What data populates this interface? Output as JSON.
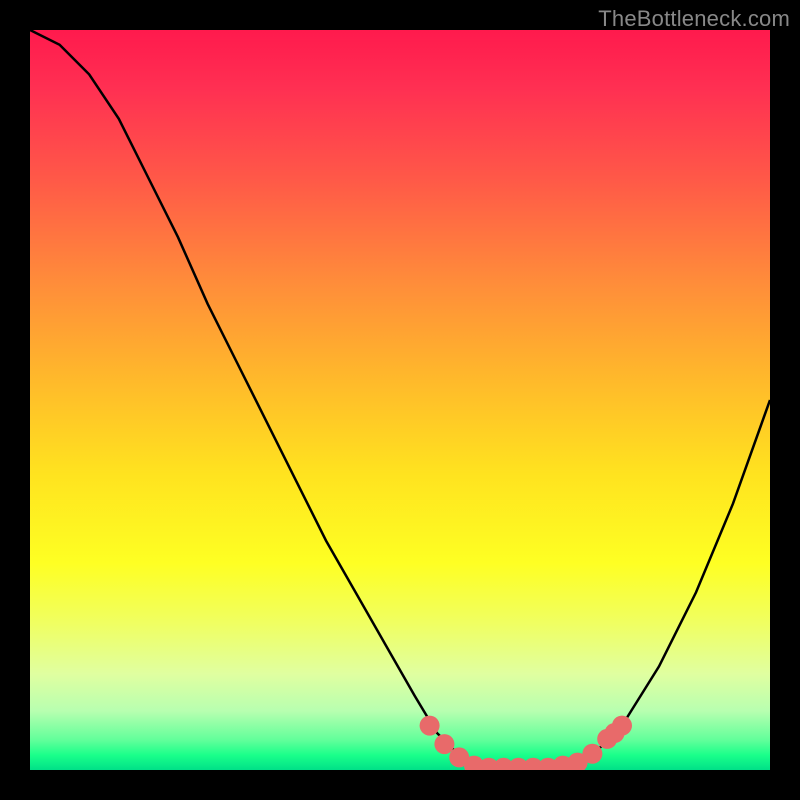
{
  "watermark": "TheBottleneck.com",
  "chart_data": {
    "type": "line",
    "title": "",
    "xlabel": "",
    "ylabel": "",
    "xlim": [
      0,
      100
    ],
    "ylim": [
      0,
      100
    ],
    "series": [
      {
        "name": "curve",
        "x": [
          0,
          4,
          8,
          12,
          16,
          20,
          24,
          28,
          32,
          36,
          40,
          44,
          48,
          52,
          55,
          58,
          60,
          65,
          70,
          75,
          80,
          85,
          90,
          95,
          100
        ],
        "y": [
          100,
          98,
          94,
          88,
          80,
          72,
          63,
          55,
          47,
          39,
          31,
          24,
          17,
          10,
          5,
          2,
          0,
          0,
          0,
          1,
          6,
          14,
          24,
          36,
          50
        ]
      }
    ],
    "highlight_points": {
      "name": "highlight",
      "color": "#e86a6a",
      "x": [
        54,
        56,
        58,
        60,
        62,
        64,
        66,
        68,
        70,
        72,
        74,
        76,
        78,
        79,
        80
      ],
      "y": [
        6,
        3.5,
        1.7,
        0.6,
        0.3,
        0.3,
        0.3,
        0.3,
        0.3,
        0.6,
        1.0,
        2.2,
        4.2,
        5.0,
        6.0
      ]
    }
  }
}
